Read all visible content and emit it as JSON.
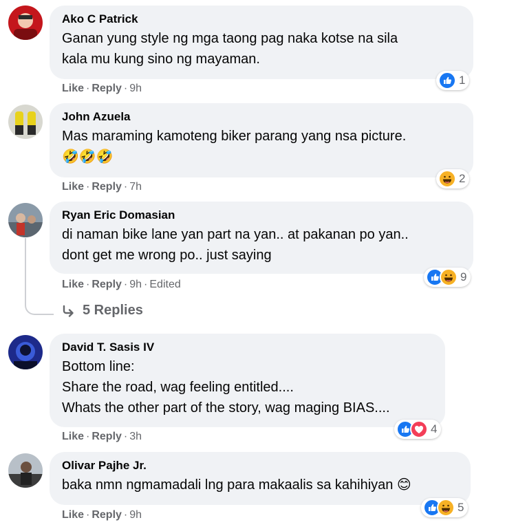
{
  "comments": [
    {
      "author": "Ako C Patrick",
      "text": "Ganan yung style ng mga taong pag naka kotse na sila\nkala mu kung sino ng mayaman.",
      "like": "Like",
      "reply": "Reply",
      "time": "9h",
      "reaction_count": "1",
      "reactions": [
        "like-icon"
      ]
    },
    {
      "author": "John Azuela",
      "text": "Mas maraming kamoteng biker parang yang nsa picture.",
      "emojis": "🤣🤣🤣",
      "like": "Like",
      "reply": "Reply",
      "time": "7h",
      "reaction_count": "2",
      "reactions": [
        "haha-icon"
      ]
    },
    {
      "author": "Ryan Eric Domasian",
      "text": "di naman bike lane yan part na yan.. at pakanan po yan..\ndont get me wrong po.. just saying",
      "like": "Like",
      "reply": "Reply",
      "time": "9h",
      "edited": "Edited",
      "reaction_count": "9",
      "reactions": [
        "like-icon",
        "haha-icon"
      ],
      "replies_label": "5 Replies"
    },
    {
      "author": "David T. Sasis IV",
      "text": "Bottom line:\nShare the road, wag feeling entitled....\nWhats the other part of the story, wag maging BIAS....",
      "like": "Like",
      "reply": "Reply",
      "time": "3h",
      "reaction_count": "4",
      "reactions": [
        "like-icon",
        "love-icon"
      ]
    },
    {
      "author": "Olivar Pajhe Jr.",
      "text": "baka nmn ngmamadali lng para makaalis sa kahihiyan 😊",
      "like": "Like",
      "reply": "Reply",
      "time": "9h",
      "reaction_count": "5",
      "reactions": [
        "like-icon",
        "haha-icon"
      ]
    }
  ],
  "colors": {
    "bubble": "#f0f2f5",
    "muted_text": "#65676b",
    "like_blue": "#1877f2",
    "haha_yellow": "#f7b125",
    "love_red": "#f33e58"
  }
}
